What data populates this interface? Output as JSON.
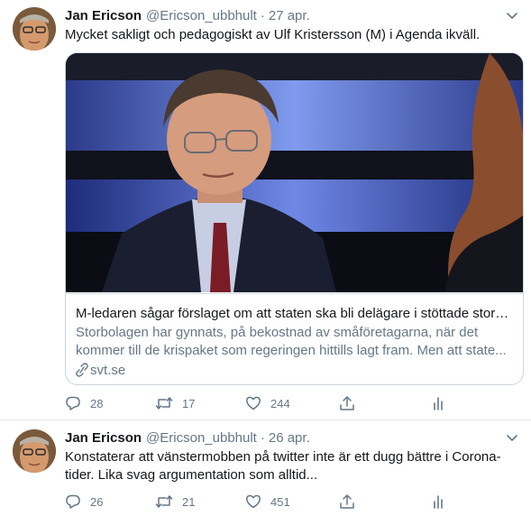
{
  "tweets": [
    {
      "author_name": "Jan Ericson",
      "handle": "@Ericson_ubbhult",
      "separator": "·",
      "date": "27 apr.",
      "text": "Mycket sakligt och pedagogiskt av Ulf Kristersson (M) i Agenda ikväll.",
      "card": {
        "title": "M-ledaren sågar förslaget om att staten ska bli delägare i stöttade storb...",
        "description": "Storbolagen har gynnats, på bekostnad av småföretagarna, när det kommer till de krispaket som regeringen hittills lagt fram. Men att state...",
        "domain": "svt.se"
      },
      "replies": "28",
      "retweets": "17",
      "likes": "244"
    },
    {
      "author_name": "Jan Ericson",
      "handle": "@Ericson_ubbhult",
      "separator": "·",
      "date": "26 apr.",
      "text": "Konstaterar att vänstermobben på twitter inte är ett dugg bättre i Corona-tider. Lika svag argumentation som alltid...",
      "replies": "26",
      "retweets": "21",
      "likes": "451"
    }
  ],
  "icons": {
    "avatar": "avatar-photo",
    "caret": "chevron-down-icon",
    "reply": "reply-icon",
    "retweet": "retweet-icon",
    "like": "heart-icon",
    "share": "share-icon",
    "stats": "analytics-icon",
    "link": "link-icon"
  },
  "colors": {
    "text": "#14171a",
    "secondary": "#657786",
    "border": "#e6ecf0"
  }
}
